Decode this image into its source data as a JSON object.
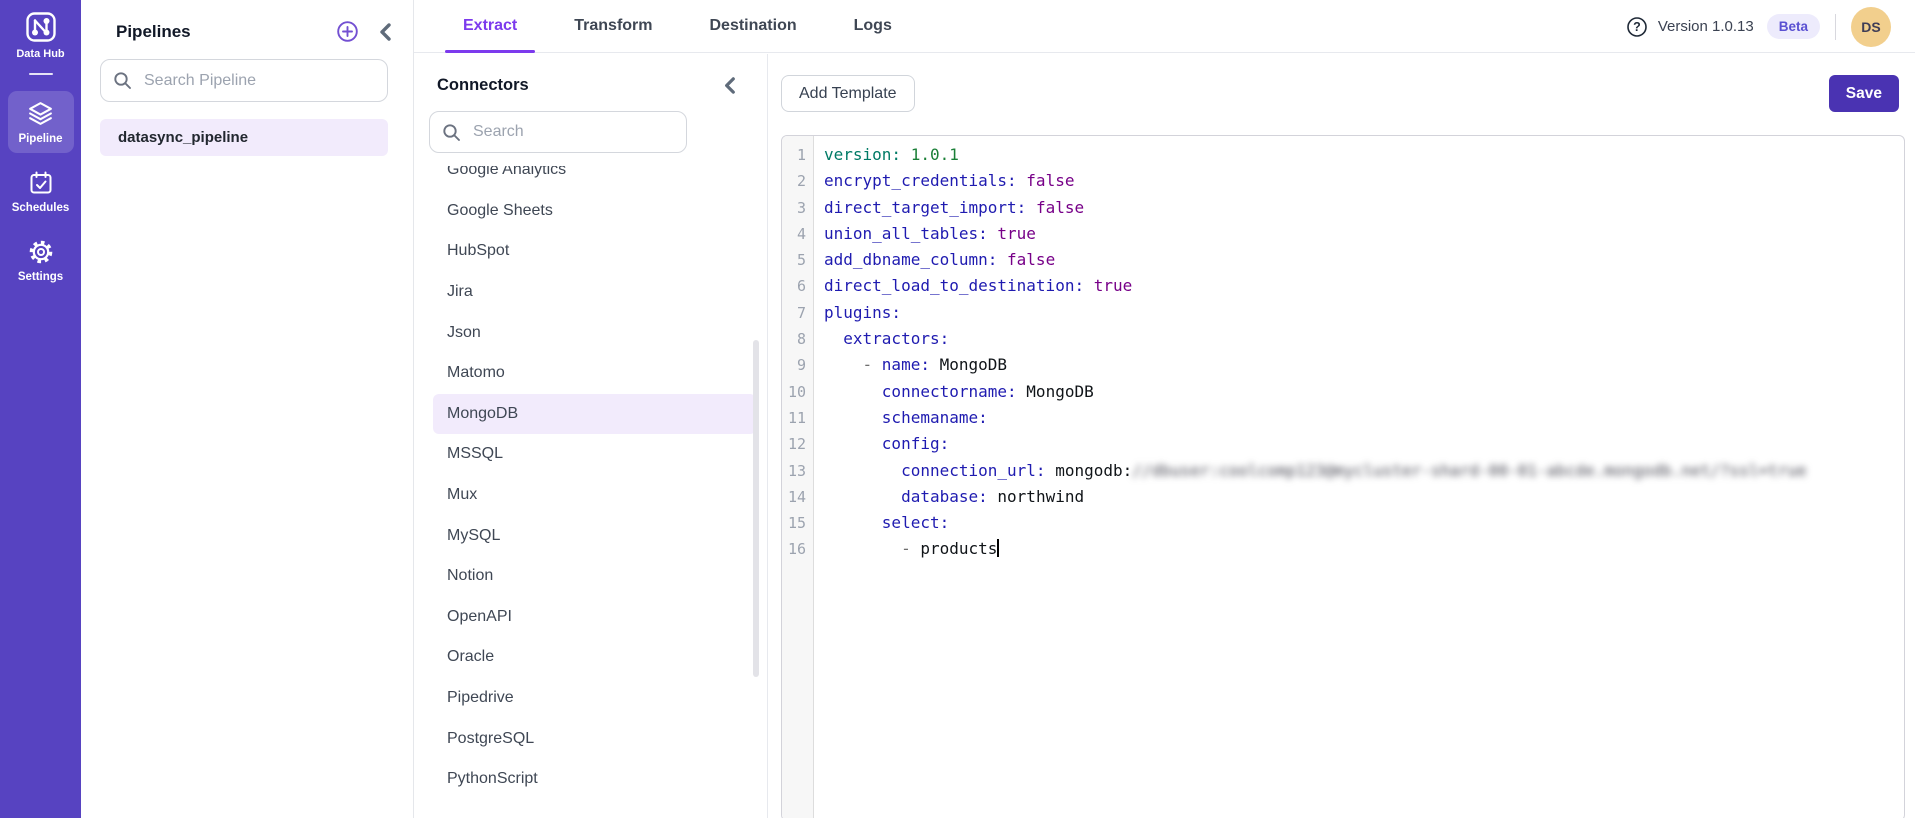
{
  "app": {
    "logo_label": "Data Hub",
    "version_label": "Version 1.0.13",
    "beta_label": "Beta",
    "avatar_initials": "DS"
  },
  "sidebar": {
    "items": [
      {
        "id": "pipeline",
        "label": "Pipeline",
        "icon": "layers-icon",
        "active": true
      },
      {
        "id": "schedules",
        "label": "Schedules",
        "icon": "calendar-check-icon",
        "active": false
      },
      {
        "id": "settings",
        "label": "Settings",
        "icon": "gear-icon",
        "active": false
      }
    ]
  },
  "pipelines_panel": {
    "title": "Pipelines",
    "search_placeholder": "Search Pipeline",
    "search_value": "",
    "items": [
      {
        "name": "datasync_pipeline",
        "selected": true
      }
    ]
  },
  "tabs": [
    {
      "label": "Extract",
      "active": true
    },
    {
      "label": "Transform",
      "active": false
    },
    {
      "label": "Destination",
      "active": false
    },
    {
      "label": "Logs",
      "active": false
    }
  ],
  "connectors_panel": {
    "title": "Connectors",
    "search_placeholder": "Search",
    "search_value": "",
    "selected": "MongoDB",
    "items": [
      "Google Analytics",
      "Google Sheets",
      "HubSpot",
      "Jira",
      "Json",
      "Matomo",
      "MongoDB",
      "MSSQL",
      "Mux",
      "MySQL",
      "Notion",
      "OpenAPI",
      "Oracle",
      "Pipedrive",
      "PostgreSQL",
      "PythonScript"
    ]
  },
  "toolbar": {
    "add_template_label": "Add Template",
    "save_label": "Save"
  },
  "editor": {
    "language": "yaml",
    "lines": [
      {
        "n": 1,
        "t": [
          [
            "type",
            "version:"
          ],
          [
            "sp",
            " "
          ],
          [
            "num",
            "1.0.1"
          ]
        ]
      },
      {
        "n": 2,
        "t": [
          [
            "key",
            "encrypt_credentials:"
          ],
          [
            "sp",
            " "
          ],
          [
            "atom",
            "false"
          ]
        ]
      },
      {
        "n": 3,
        "t": [
          [
            "key",
            "direct_target_import:"
          ],
          [
            "sp",
            " "
          ],
          [
            "atom",
            "false"
          ]
        ]
      },
      {
        "n": 4,
        "t": [
          [
            "key",
            "union_all_tables:"
          ],
          [
            "sp",
            " "
          ],
          [
            "atom",
            "true"
          ]
        ]
      },
      {
        "n": 5,
        "t": [
          [
            "key",
            "add_dbname_column:"
          ],
          [
            "sp",
            " "
          ],
          [
            "atom",
            "false"
          ]
        ]
      },
      {
        "n": 6,
        "t": [
          [
            "key",
            "direct_load_to_destination:"
          ],
          [
            "sp",
            " "
          ],
          [
            "atom",
            "true"
          ]
        ]
      },
      {
        "n": 7,
        "t": [
          [
            "key",
            "plugins:"
          ]
        ]
      },
      {
        "n": 8,
        "t": [
          [
            "sp",
            "  "
          ],
          [
            "key",
            "extractors:"
          ]
        ]
      },
      {
        "n": 9,
        "t": [
          [
            "sp",
            "    "
          ],
          [
            "meta",
            "- "
          ],
          [
            "key",
            "name:"
          ],
          [
            "sp",
            " "
          ],
          [
            "plain",
            "MongoDB"
          ]
        ]
      },
      {
        "n": 10,
        "t": [
          [
            "sp",
            "      "
          ],
          [
            "key",
            "connectorname:"
          ],
          [
            "sp",
            " "
          ],
          [
            "plain",
            "MongoDB"
          ]
        ]
      },
      {
        "n": 11,
        "t": [
          [
            "sp",
            "      "
          ],
          [
            "key",
            "schemaname:"
          ]
        ]
      },
      {
        "n": 12,
        "t": [
          [
            "sp",
            "      "
          ],
          [
            "key",
            "config:"
          ]
        ]
      },
      {
        "n": 13,
        "t": [
          [
            "sp",
            "        "
          ],
          [
            "key",
            "connection_url:"
          ],
          [
            "sp",
            " "
          ],
          [
            "plain",
            "mongodb:"
          ],
          [
            "redacted",
            "//dbuser:coolcomp123@mycluster-shard-00-01-abcde.mongodb.net/?ssl=true"
          ]
        ],
        "redacted": true
      },
      {
        "n": 14,
        "t": [
          [
            "sp",
            "        "
          ],
          [
            "key",
            "database:"
          ],
          [
            "sp",
            " "
          ],
          [
            "plain",
            "northwind"
          ]
        ]
      },
      {
        "n": 15,
        "t": [
          [
            "sp",
            "      "
          ],
          [
            "key",
            "select:"
          ]
        ]
      },
      {
        "n": 16,
        "t": [
          [
            "sp",
            "        "
          ],
          [
            "meta",
            "- "
          ],
          [
            "plain",
            "products"
          ]
        ],
        "cursor": true
      }
    ]
  },
  "colors": {
    "sidebar_bg": "#5743c1",
    "accent_purple": "#7c3aed",
    "save_button_bg": "#4a33b2",
    "selected_row_bg": "#f2ebfc",
    "beta_badge_bg": "#edebfc",
    "beta_badge_text": "#5a50d2",
    "avatar_bg": "#f2cf8d",
    "code_key": "#1f1bb0",
    "code_atom": "#770088",
    "code_number": "#1a7f37",
    "code_type": "#007a66"
  }
}
